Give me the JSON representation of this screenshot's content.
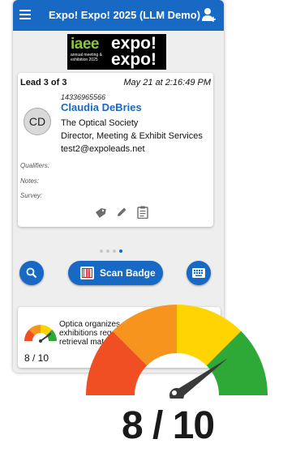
{
  "app": {
    "title": "Expo! Expo! 2025 (LLM Demo)"
  },
  "logo": {
    "brand": "iaee",
    "sub": "annual meeting & exhibition 2025",
    "word1": "expo!",
    "word2": "expo!"
  },
  "lead": {
    "counter": "Lead 3 of 3",
    "timestamp": "May 21 at 2:16:49 PM",
    "badge_id": "14336965566",
    "initials": "CD",
    "name": "Claudia DeBries",
    "organization": "The Optical Society",
    "job_title": "Director, Meeting & Exhibit Services",
    "email": "test2@expoleads.net",
    "labels": {
      "qualifiers": "Qualifiers:",
      "notes": "Notes:",
      "survey": "Survey:"
    }
  },
  "pager": {
    "count": 4,
    "active_index": 3
  },
  "actions": {
    "scan_label": "Scan Badge",
    "search_icon": "search-icon",
    "keyboard_icon": "keyboard-icon"
  },
  "score": {
    "value": 8,
    "max": 10,
    "display": "8 / 10",
    "summary": "Optica organizes exhibitions req lead retrieval match for E"
  },
  "colors": {
    "primary": "#1769c4",
    "gauge_red": "#f04e23",
    "gauge_orange": "#f7941d",
    "gauge_yellow": "#ffd400",
    "gauge_green": "#2ea836",
    "needle": "#3a3a3a"
  }
}
